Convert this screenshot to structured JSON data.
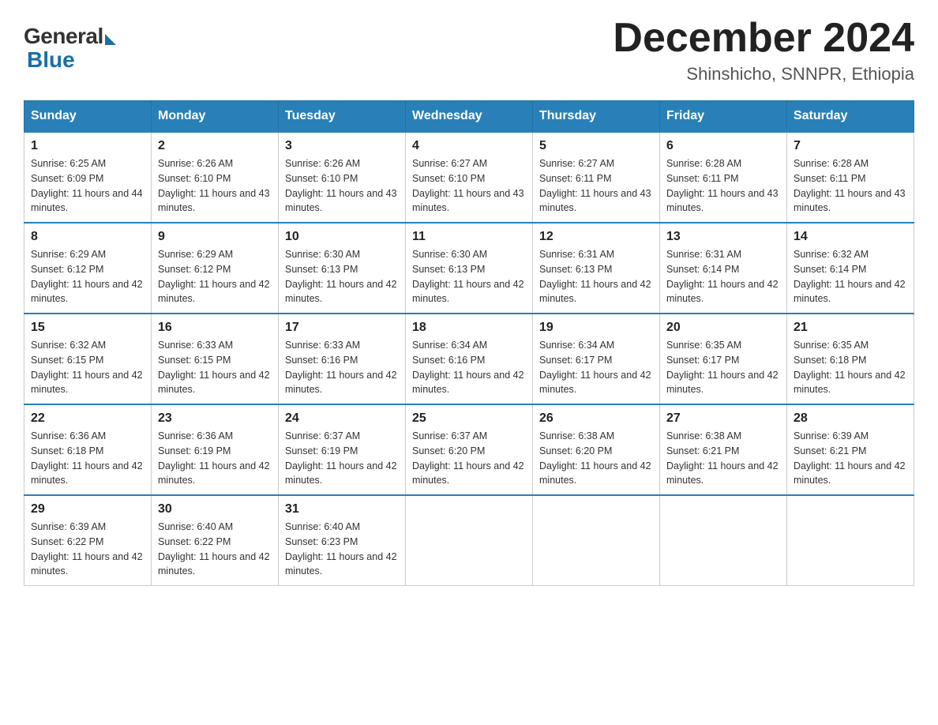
{
  "logo": {
    "general": "General",
    "blue": "Blue"
  },
  "title": "December 2024",
  "location": "Shinshicho, SNNPR, Ethiopia",
  "days_of_week": [
    "Sunday",
    "Monday",
    "Tuesday",
    "Wednesday",
    "Thursday",
    "Friday",
    "Saturday"
  ],
  "weeks": [
    [
      {
        "day": "1",
        "sunrise": "6:25 AM",
        "sunset": "6:09 PM",
        "daylight": "11 hours and 44 minutes."
      },
      {
        "day": "2",
        "sunrise": "6:26 AM",
        "sunset": "6:10 PM",
        "daylight": "11 hours and 43 minutes."
      },
      {
        "day": "3",
        "sunrise": "6:26 AM",
        "sunset": "6:10 PM",
        "daylight": "11 hours and 43 minutes."
      },
      {
        "day": "4",
        "sunrise": "6:27 AM",
        "sunset": "6:10 PM",
        "daylight": "11 hours and 43 minutes."
      },
      {
        "day": "5",
        "sunrise": "6:27 AM",
        "sunset": "6:11 PM",
        "daylight": "11 hours and 43 minutes."
      },
      {
        "day": "6",
        "sunrise": "6:28 AM",
        "sunset": "6:11 PM",
        "daylight": "11 hours and 43 minutes."
      },
      {
        "day": "7",
        "sunrise": "6:28 AM",
        "sunset": "6:11 PM",
        "daylight": "11 hours and 43 minutes."
      }
    ],
    [
      {
        "day": "8",
        "sunrise": "6:29 AM",
        "sunset": "6:12 PM",
        "daylight": "11 hours and 42 minutes."
      },
      {
        "day": "9",
        "sunrise": "6:29 AM",
        "sunset": "6:12 PM",
        "daylight": "11 hours and 42 minutes."
      },
      {
        "day": "10",
        "sunrise": "6:30 AM",
        "sunset": "6:13 PM",
        "daylight": "11 hours and 42 minutes."
      },
      {
        "day": "11",
        "sunrise": "6:30 AM",
        "sunset": "6:13 PM",
        "daylight": "11 hours and 42 minutes."
      },
      {
        "day": "12",
        "sunrise": "6:31 AM",
        "sunset": "6:13 PM",
        "daylight": "11 hours and 42 minutes."
      },
      {
        "day": "13",
        "sunrise": "6:31 AM",
        "sunset": "6:14 PM",
        "daylight": "11 hours and 42 minutes."
      },
      {
        "day": "14",
        "sunrise": "6:32 AM",
        "sunset": "6:14 PM",
        "daylight": "11 hours and 42 minutes."
      }
    ],
    [
      {
        "day": "15",
        "sunrise": "6:32 AM",
        "sunset": "6:15 PM",
        "daylight": "11 hours and 42 minutes."
      },
      {
        "day": "16",
        "sunrise": "6:33 AM",
        "sunset": "6:15 PM",
        "daylight": "11 hours and 42 minutes."
      },
      {
        "day": "17",
        "sunrise": "6:33 AM",
        "sunset": "6:16 PM",
        "daylight": "11 hours and 42 minutes."
      },
      {
        "day": "18",
        "sunrise": "6:34 AM",
        "sunset": "6:16 PM",
        "daylight": "11 hours and 42 minutes."
      },
      {
        "day": "19",
        "sunrise": "6:34 AM",
        "sunset": "6:17 PM",
        "daylight": "11 hours and 42 minutes."
      },
      {
        "day": "20",
        "sunrise": "6:35 AM",
        "sunset": "6:17 PM",
        "daylight": "11 hours and 42 minutes."
      },
      {
        "day": "21",
        "sunrise": "6:35 AM",
        "sunset": "6:18 PM",
        "daylight": "11 hours and 42 minutes."
      }
    ],
    [
      {
        "day": "22",
        "sunrise": "6:36 AM",
        "sunset": "6:18 PM",
        "daylight": "11 hours and 42 minutes."
      },
      {
        "day": "23",
        "sunrise": "6:36 AM",
        "sunset": "6:19 PM",
        "daylight": "11 hours and 42 minutes."
      },
      {
        "day": "24",
        "sunrise": "6:37 AM",
        "sunset": "6:19 PM",
        "daylight": "11 hours and 42 minutes."
      },
      {
        "day": "25",
        "sunrise": "6:37 AM",
        "sunset": "6:20 PM",
        "daylight": "11 hours and 42 minutes."
      },
      {
        "day": "26",
        "sunrise": "6:38 AM",
        "sunset": "6:20 PM",
        "daylight": "11 hours and 42 minutes."
      },
      {
        "day": "27",
        "sunrise": "6:38 AM",
        "sunset": "6:21 PM",
        "daylight": "11 hours and 42 minutes."
      },
      {
        "day": "28",
        "sunrise": "6:39 AM",
        "sunset": "6:21 PM",
        "daylight": "11 hours and 42 minutes."
      }
    ],
    [
      {
        "day": "29",
        "sunrise": "6:39 AM",
        "sunset": "6:22 PM",
        "daylight": "11 hours and 42 minutes."
      },
      {
        "day": "30",
        "sunrise": "6:40 AM",
        "sunset": "6:22 PM",
        "daylight": "11 hours and 42 minutes."
      },
      {
        "day": "31",
        "sunrise": "6:40 AM",
        "sunset": "6:23 PM",
        "daylight": "11 hours and 42 minutes."
      },
      null,
      null,
      null,
      null
    ]
  ]
}
